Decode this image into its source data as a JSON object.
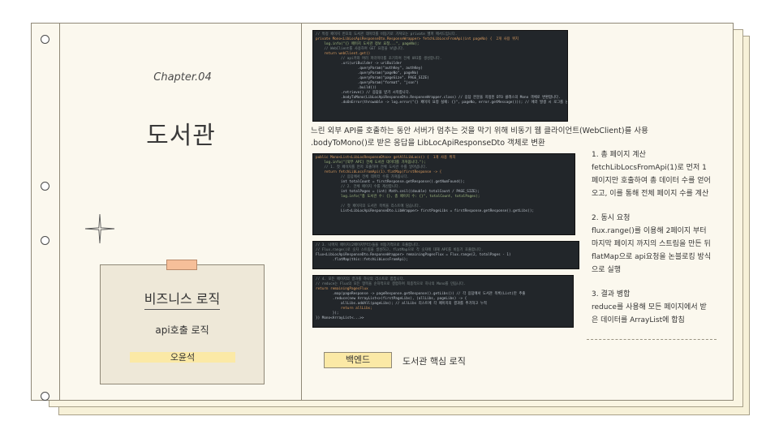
{
  "chapter": {
    "label": "Chapter.04",
    "title": "도서관"
  },
  "card": {
    "title": "비즈니스 로직",
    "subtitle": "api호출 로직",
    "author": "오윤석"
  },
  "code_snippets": {
    "snippet1": [
      "// 특정 페이지 번호의 도서관 데이터를 비동기로 가져오는 private 헬퍼 메서드입니다.",
      "private Mono<LibLocApiResponseDto.ResponseWrapper> fetchLibLocsFromApi(int pageNo) {  2개 사용 위치",
      "    log.info(\"{} 페이지 도서관 정보 요청...\", pageNo);",
      "    // WebClient를 사용하여 GET 요청을 보냅니다.",
      "    return webClient.get()",
      "            // api키와 여러 파라미터를 조기하여 전체 URI를 생성합니다.",
      "            .uri(uriBuilder -> uriBuilder",
      "                    .queryParam(\"authKey\", authKey)",
      "                    .queryParam(\"pageNo\", pageNo)",
      "                    .queryParam(\"pageSize\", PAGE_SIZE)",
      "                    .queryParam(\"format\", \"json\")",
      "                    .build())",
      "            .retrieve() // 응답을 받기 시작합니다.",
      "            .bodyToMono(LibLocApiResponseDto.ResponseWrapper.class) // 응답 본문을 지정된 DTO 클래스의 Mono 객체로 변환합니다.",
      "            .doOnError(throwable -> log.error(\"{} 페이지 요청 실패: {}\", pageNo, error.getMessage())); // 에러 발생 시 로그를 남깁니다."
    ],
    "snippet2": [
      "public Mono<List<LibLocResponseDto>> getAllLibLocs() {  1개 사용 위치",
      "    log.info(\"[외부 API] 전체 도서관 데이터를 가져옵니다.\");",
      "    // 1. 첫 페이지를 먼저 호출하여 전체 도서관 수를 알아냅니다.",
      "    return fetchLibLocsFromApi(1).flatMap(firstResponse -> {",
      "            // 응답에서 전체 데이터 수를 가져옵니다.",
      "            int totalCount = firstResponse.getResponse().getNumFound();",
      "            // 2. 전체 페이지 수를 계산합니다.",
      "            int totalPages = (int) Math.ceil((double) totalCount / PAGE_SIZE);",
      "            log.info(\"총 도서관 수: {}, 총 페이지 수: {}\", totalCount, totalPages);",
      "",
      "            // 첫 페이지의 도서관 목록을 리스트에 담습니다.",
      "            List<LibLocApiResponseDto.LibWrapper> firstPageLibs = firstResponse.getResponse().getLibs();"
    ],
    "snippet3": [
      "// 3. 나머지 페이지(2페이지부터)들을 비동기적으로 호출합니다.",
      "// Flux.range()로 숫자 스트림을 생성하고, flatMap으로 각 숫자에 대해 API를 비동기 호출합니다.",
      "Flux<LibLocApiResponseDto.ResponseWrapper> remainingPagesFlux = Flux.range(2, totalPages - 1)",
      "        .flatMap(this::fetchLibLocsFromApi);"
    ],
    "snippet4": [
      "// 4. 모든 페이지의 결과를 하나의 리스트로 합칩니다.",
      "// reduce는 Flux의 모든 항목을 순차적으로 결합하여 최종적으로 하나의 Mono를 만듭니다.",
      "return remainingPagesFlux",
      "        .map(pageResponse -> pageResponse.getResponse().getLibs()) // 각 응답에서 도서관 목록(List)만 추출",
      "        .reduce(new ArrayList<>(firstPageLibs), (allLibs, pageLibs) -> {",
      "            allLibs.addAll(pageLibs); // allLibs 리스트에 각 페이지의 결과를 추가하고 누적",
      "            return allLibs;",
      "        });",
      "}) Mono<ArrayList<...>>"
    ]
  },
  "captions": {
    "line1": "느린 외부 API를 호출하는 동안 서버가 멈추는 것을 막기 위해 비동기 웹 클라이언트(WebClient)를 사용",
    "line2": ".bodyToMono()로 받은 응답을 LibLocApiResponseDto 객체로 변환"
  },
  "steps": [
    {
      "heading": "1. 총 페이지 계산",
      "body": "fetchLibLocsFromApi(1)로 먼저 1페이지만 호출하여 총 데이터 수를 얻어오고, 이를 통해 전체 페이지 수를 계산"
    },
    {
      "heading": "2. 동시 요청",
      "body": "flux.range()를 이용해 2페이지 부터 마지막 페이지 까지의 스트림을 만든 뒤 flatMap으로 api요청을 논블로킹 방식으로 실행"
    },
    {
      "heading": "3. 결과 병합",
      "body": "reduce를 사용해 모든 페이지에서 받은 데이터를 ArrayList에 합침"
    }
  ],
  "footer": {
    "tag": "백엔드",
    "description": "도서관 핵심 로직"
  }
}
